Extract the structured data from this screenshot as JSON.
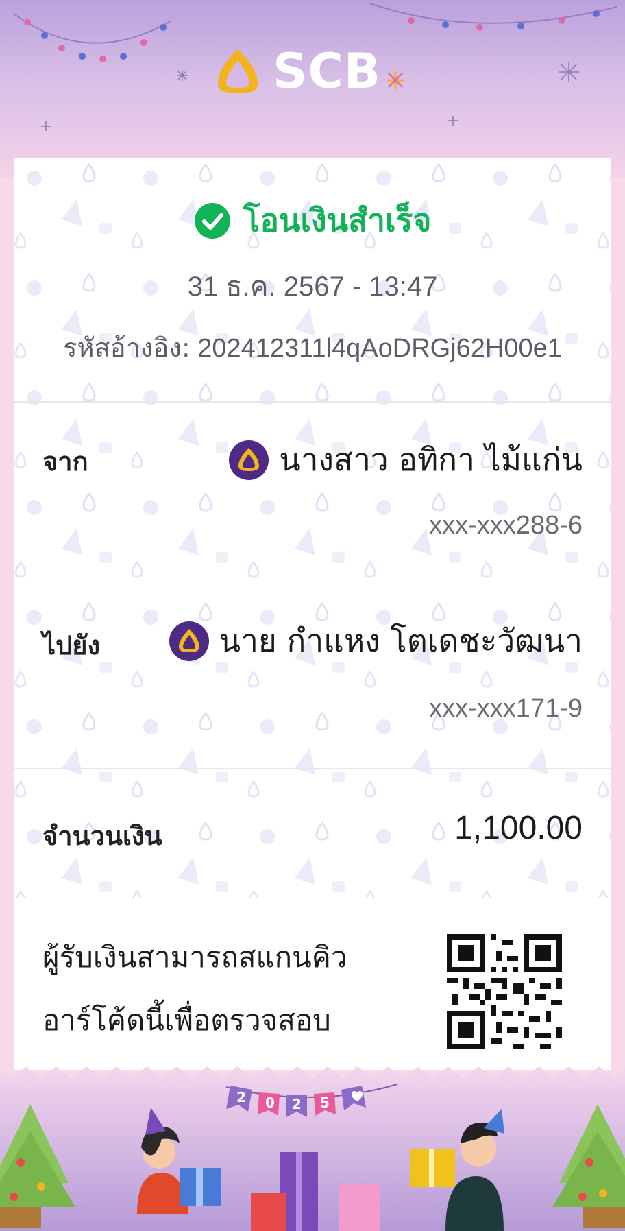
{
  "brand": {
    "name": "SCB"
  },
  "status": {
    "text": "โอนเงินสำเร็จ"
  },
  "datetime": "31 ธ.ค. 2567 - 13:47",
  "reference": {
    "label": "รหัสอ้างอิง:",
    "value": "202412311l4qAoDRGj62H00e1"
  },
  "from": {
    "label": "จาก",
    "name": "นางสาว อทิกา ไม้แก่น",
    "account": "xxx-xxx288-6"
  },
  "to": {
    "label": "ไปยัง",
    "name": "นาย กำแหง โตเดชะวัฒนา",
    "account": "xxx-xxx171-9"
  },
  "amount": {
    "label": "จำนวนเงิน",
    "value": "1,100.00"
  },
  "qr_note": {
    "line1": "ผู้รับเงินสามารถสแกนคิว",
    "line2": "อาร์โค้ดนี้เพื่อตรวจสอบ"
  },
  "banner": {
    "digits": [
      "2",
      "0",
      "2",
      "5"
    ]
  },
  "colors": {
    "success": "#12b357",
    "brand_purple": "#4e2a84",
    "brand_gold": "#f2b31c"
  }
}
